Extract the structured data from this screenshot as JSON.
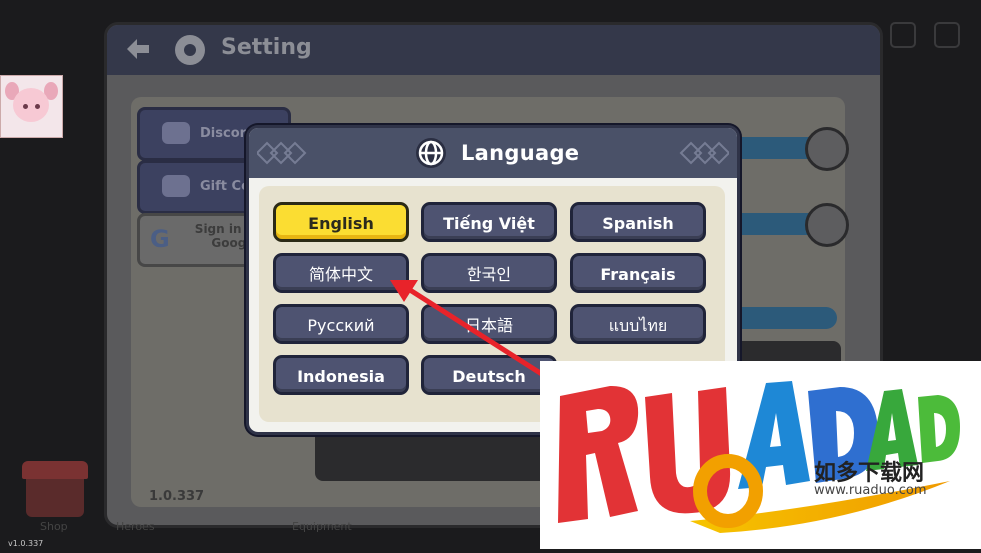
{
  "settings": {
    "title": "Setting",
    "buttons": {
      "discord": "Discord",
      "gift_code": "Gift Code",
      "google_signin": "Sign in with Google"
    },
    "version": "1.0.337"
  },
  "language_dialog": {
    "title": "Language",
    "options": [
      {
        "label": "English",
        "selected": true
      },
      {
        "label": "Tiếng Việt",
        "selected": false
      },
      {
        "label": "Spanish",
        "selected": false
      },
      {
        "label": "简体中文",
        "selected": false
      },
      {
        "label": "한국인",
        "selected": false
      },
      {
        "label": "Français",
        "selected": false
      },
      {
        "label": "Русский",
        "selected": false
      },
      {
        "label": "日本語",
        "selected": false
      },
      {
        "label": "แบบไทย",
        "selected": false
      },
      {
        "label": "Indonesia",
        "selected": false
      },
      {
        "label": "Deutsch",
        "selected": false
      }
    ]
  },
  "bottom_nav": [
    "Shop",
    "Heroes",
    "Equipment"
  ],
  "app_version": "v1.0.337",
  "watermark": {
    "logo": "RUADADO",
    "chinese": "如多下载网",
    "url": "www.ruaduo.com"
  },
  "colors": {
    "selected": "#fbdd32",
    "button": "#4e5371",
    "annotation_arrow": "#e8232a"
  }
}
